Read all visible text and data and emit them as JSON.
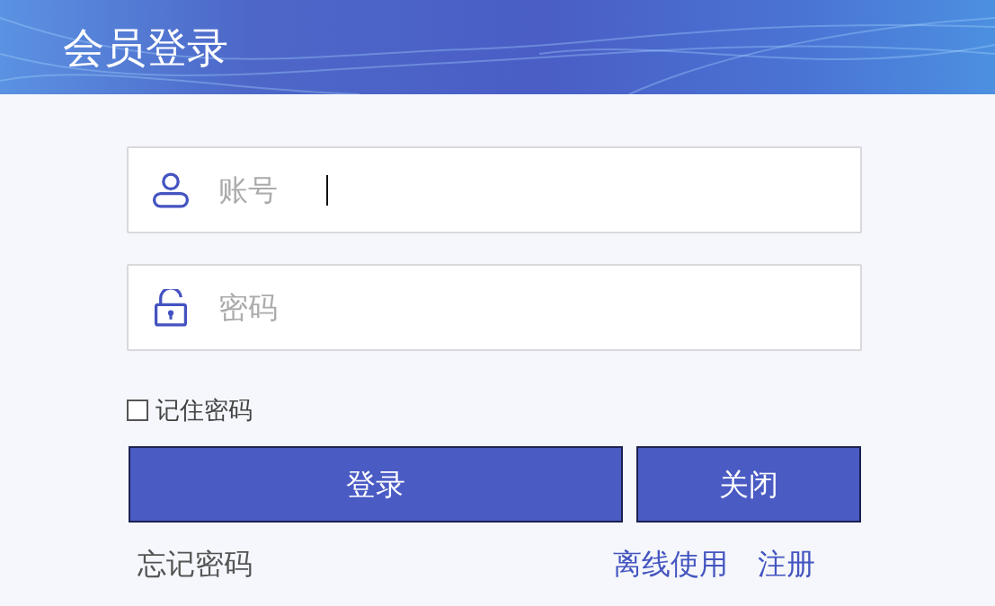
{
  "header": {
    "title": "会员登录"
  },
  "fields": [
    {
      "kind": "account",
      "label": "账号",
      "focused": true
    },
    {
      "kind": "password",
      "label": "密码",
      "focused": false
    }
  ],
  "remember": {
    "label": "记住密码",
    "checked": false
  },
  "buttons": [
    {
      "label": "登录"
    },
    {
      "label": "关闭"
    }
  ],
  "links": [
    {
      "label": "忘记密码",
      "kind": "plain"
    },
    {
      "label": "离线使用",
      "kind": "accent"
    },
    {
      "label": "注册",
      "kind": "accent"
    }
  ]
}
